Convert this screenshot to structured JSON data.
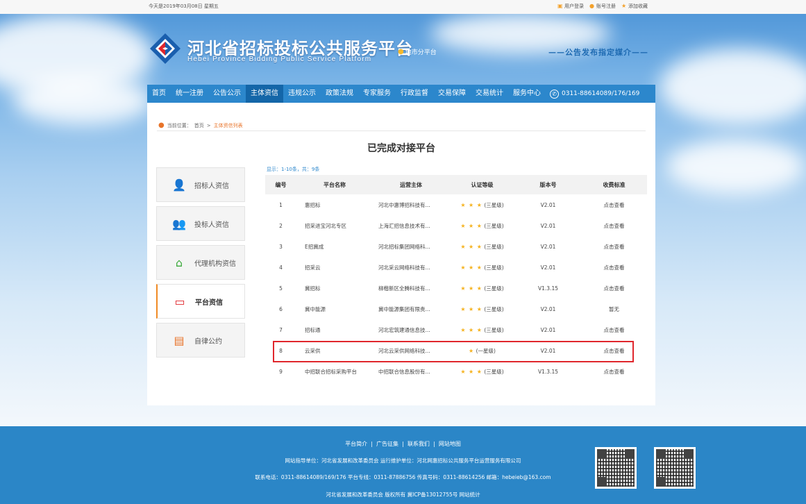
{
  "topbar": {
    "date": "今天是2019年03月08日 星期五",
    "links": [
      {
        "icon": "user-lock-icon",
        "label": "用户登录"
      },
      {
        "icon": "person-icon",
        "label": "账号注册"
      },
      {
        "icon": "star-icon",
        "label": "添加收藏"
      }
    ]
  },
  "header": {
    "title": "河北省招标投标公共服务平台",
    "subtitle": "Hebei Province Bidding Public Service Platform",
    "sub_platform": "地市分平台",
    "media_tag": "——公告发布指定媒介——"
  },
  "nav": {
    "items": [
      "首页",
      "统一注册",
      "公告公示",
      "主体资信",
      "违规公示",
      "政策法规",
      "专家服务",
      "行政监督",
      "交易保障",
      "交易统计",
      "服务中心"
    ],
    "active": "主体资信",
    "phone": "0311-88614089/176/169"
  },
  "breadcrumb": {
    "label": "当前位置：",
    "home": "首页",
    "sep": ">",
    "current": "主体资信列表"
  },
  "page_title": "已完成对接平台",
  "sidebar": {
    "items": [
      {
        "icon": "user-icon",
        "label": "招标人资信"
      },
      {
        "icon": "users-icon",
        "label": "投标人资信"
      },
      {
        "icon": "home-icon",
        "label": "代理机构资信"
      },
      {
        "icon": "monitor-icon",
        "label": "平台资信",
        "active": true
      },
      {
        "icon": "document-icon",
        "label": "自律公约"
      }
    ]
  },
  "table": {
    "showing": "显示：1-10条，共：9条",
    "headers": [
      "编号",
      "平台名称",
      "运营主体",
      "认证等级",
      "版本号",
      "收费标准"
    ],
    "rows": [
      {
        "no": "1",
        "name": "惠招标",
        "operator": "河北中惠博招科技有...",
        "stars": "★ ★ ★",
        "level": "(三星级)",
        "version": "V2.01",
        "fee": "点击查看"
      },
      {
        "no": "2",
        "name": "招采进宝河北专区",
        "operator": "上海汇招信息技术有...",
        "stars": "★ ★ ★",
        "level": "(三星级)",
        "version": "V2.01",
        "fee": "点击查看"
      },
      {
        "no": "3",
        "name": "E招冀成",
        "operator": "河北招标集团网络科...",
        "stars": "★ ★ ★",
        "level": "(三星级)",
        "version": "V2.01",
        "fee": "点击查看"
      },
      {
        "no": "4",
        "name": "招采云",
        "operator": "河北采云网络科技有...",
        "stars": "★ ★ ★",
        "level": "(三星级)",
        "version": "V2.01",
        "fee": "点击查看"
      },
      {
        "no": "5",
        "name": "冀招标",
        "operator": "柳楷新区全腾科技有...",
        "stars": "★ ★ ★",
        "level": "(三星级)",
        "version": "V1.3.15",
        "fee": "点击查看"
      },
      {
        "no": "6",
        "name": "冀中能源",
        "operator": "冀中能源集团有限责...",
        "stars": "★ ★ ★",
        "level": "(三星级)",
        "version": "V2.01",
        "fee": "暂无"
      },
      {
        "no": "7",
        "name": "招标通",
        "operator": "河北宏筑建通信息技...",
        "stars": "★ ★ ★",
        "level": "(三星级)",
        "version": "V2.01",
        "fee": "点击查看"
      },
      {
        "no": "8",
        "name": "云采供",
        "operator": "河北云采供网络科技...",
        "stars": "★",
        "level": "(一星级)",
        "version": "V2.01",
        "fee": "点击查看"
      },
      {
        "no": "9",
        "name": "中招联合招标采购平台",
        "operator": "中招联合信息股份有...",
        "stars": "★ ★ ★",
        "level": "(三星级)",
        "version": "V1.3.15",
        "fee": "点击查看"
      }
    ]
  },
  "footer": {
    "links": [
      "平台简介",
      "广告征集",
      "联系我们",
      "网站地图"
    ],
    "sep": "|",
    "line1": "网站指导单位：河北省发展和改革委员会   运行维护单位：河北网惠招标公共服务平台运营服务有限公司",
    "line2": "联系电话：0311-88614089/169/176   平台专线：0311-87886756   传真号码：0311-88614256   邮箱：hebeieb@163.com",
    "line3": "河北省发展和改革委员会 版权所有   冀ICP备13012755号   网站统计"
  }
}
